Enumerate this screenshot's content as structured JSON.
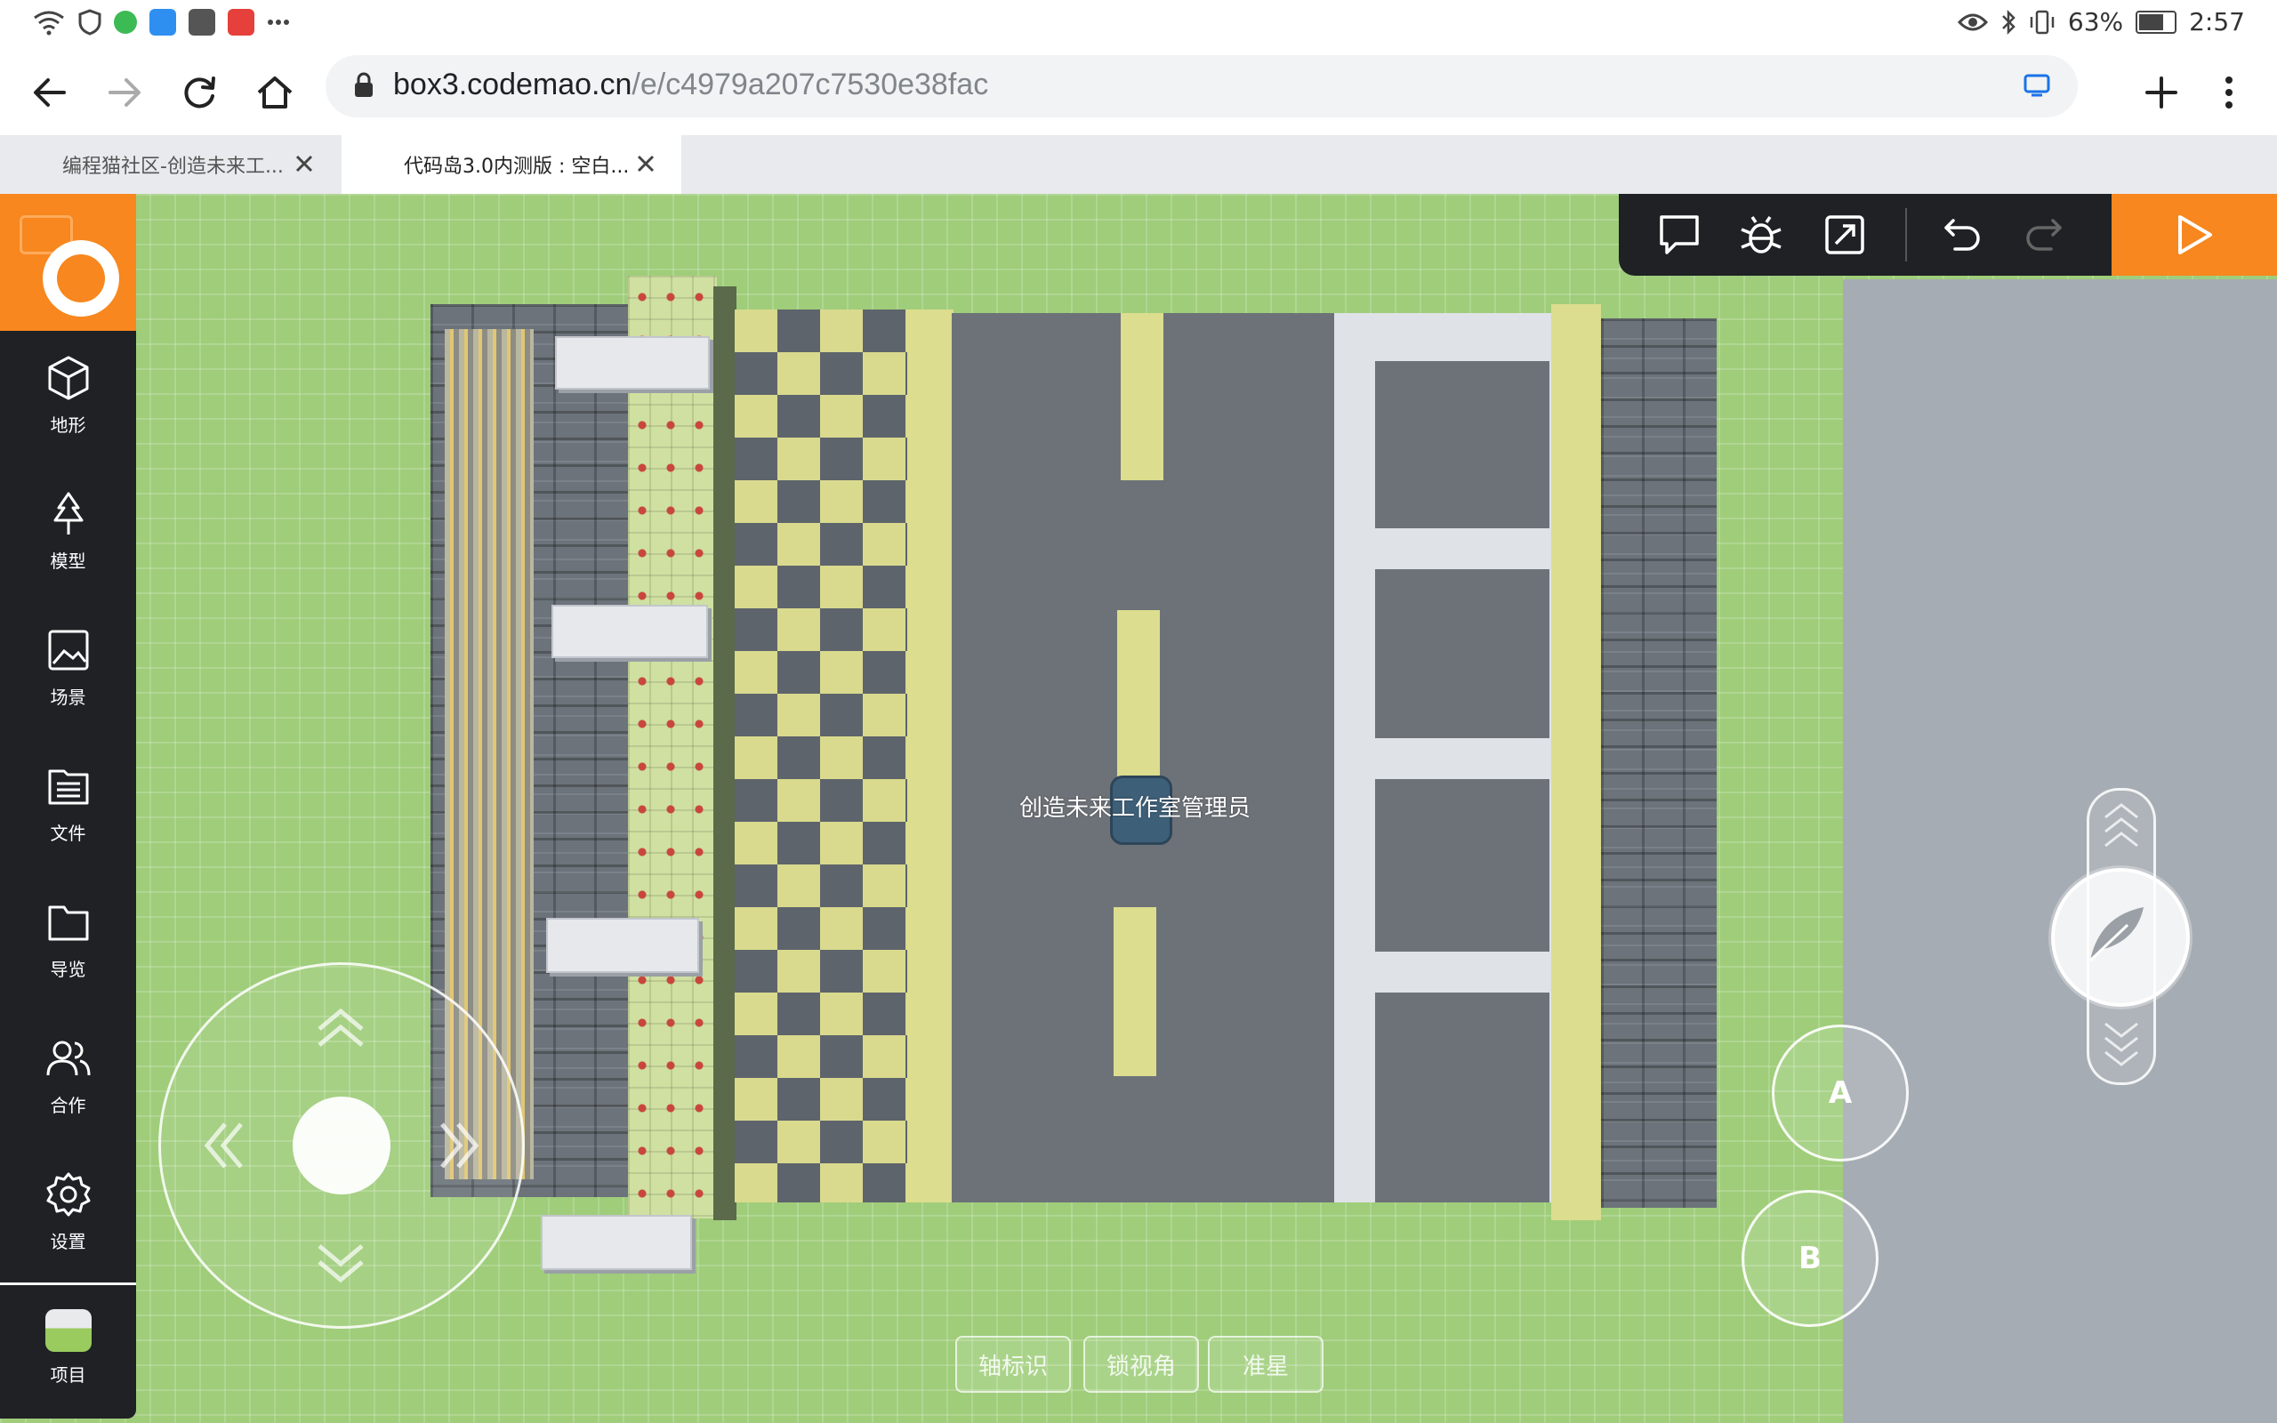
{
  "status_bar": {
    "battery": "63%",
    "time": "2:57",
    "battery_level": 0.63
  },
  "browser": {
    "url_host": "box3.codemao.cn",
    "url_path": "/e/c4979a207c7530e38fac",
    "tabs": [
      {
        "title": "编程猫社区-创造未来工..."
      },
      {
        "title": "代码岛3.0内测版 : 空白..."
      }
    ]
  },
  "sidebar": {
    "items": [
      {
        "label": "地形",
        "icon": "cube-icon"
      },
      {
        "label": "模型",
        "icon": "tree-icon"
      },
      {
        "label": "场景",
        "icon": "image-icon"
      },
      {
        "label": "文件",
        "icon": "file-list-icon"
      },
      {
        "label": "导览",
        "icon": "folder-icon"
      },
      {
        "label": "合作",
        "icon": "users-icon"
      },
      {
        "label": "设置",
        "icon": "gear-icon"
      },
      {
        "label": "项目",
        "icon": "gem-icon"
      }
    ]
  },
  "editor_tools": [
    "comment-icon",
    "debug-bug-icon",
    "resize-icon",
    "undo-icon",
    "redo-icon",
    "play-icon"
  ],
  "scene": {
    "player_name": "创造未来工作室管理员"
  },
  "controls": {
    "button_a": "A",
    "button_b": "B",
    "bottom_buttons": [
      "轴标识",
      "锁视角",
      "准星"
    ]
  },
  "colors": {
    "accent": "#f7871e",
    "grass": "#9fcd7a",
    "sidebar": "#1f2125"
  }
}
